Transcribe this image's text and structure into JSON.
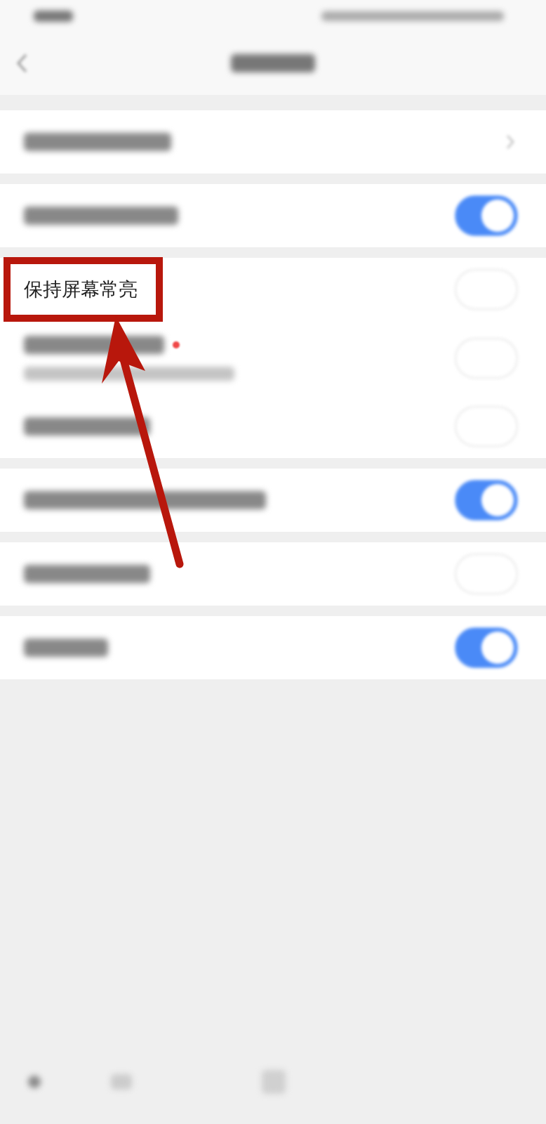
{
  "groups": [
    {
      "rows": [
        {
          "kind": "link"
        }
      ]
    },
    {
      "rows": [
        {
          "kind": "toggle",
          "on": true
        }
      ]
    },
    {
      "rows": [
        {
          "kind": "toggle",
          "on": false,
          "label": "保持屏幕常亮",
          "highlighted": true
        },
        {
          "kind": "toggle_note",
          "on": false,
          "dot": true
        },
        {
          "kind": "toggle",
          "on": false
        }
      ]
    },
    {
      "rows": [
        {
          "kind": "toggle",
          "on": true
        }
      ]
    },
    {
      "rows": [
        {
          "kind": "toggle",
          "on": false
        }
      ]
    },
    {
      "rows": [
        {
          "kind": "toggle",
          "on": true
        }
      ]
    }
  ]
}
